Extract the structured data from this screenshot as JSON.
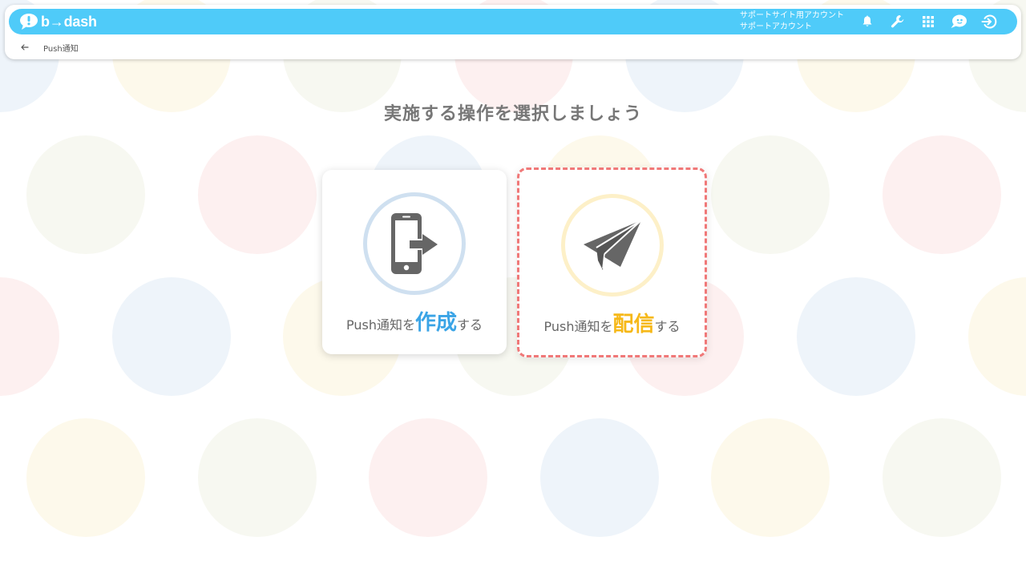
{
  "header": {
    "logo_text": "b→dash",
    "account_line1": "サポートサイト用アカウント",
    "account_line2": "サポートアカウント",
    "icons": [
      "bell-icon",
      "wrench-icon",
      "grid-icon",
      "support-icon",
      "logout-icon"
    ],
    "color": "#4fcbf9"
  },
  "breadcrumb": {
    "back_icon": "arrow-left-icon",
    "current": "Push通知"
  },
  "main": {
    "title": "実施する操作を選択しましょう",
    "cards": [
      {
        "icon": "phone-export-icon",
        "prefix": "Push通知を",
        "emphasis": "作成",
        "suffix": "する",
        "emphasis_color": "#3aa4e6",
        "selected": false
      },
      {
        "icon": "paper-plane-icon",
        "prefix": "Push通知を",
        "emphasis": "配信",
        "suffix": "する",
        "emphasis_color": "#f6b818",
        "selected": true
      }
    ]
  }
}
